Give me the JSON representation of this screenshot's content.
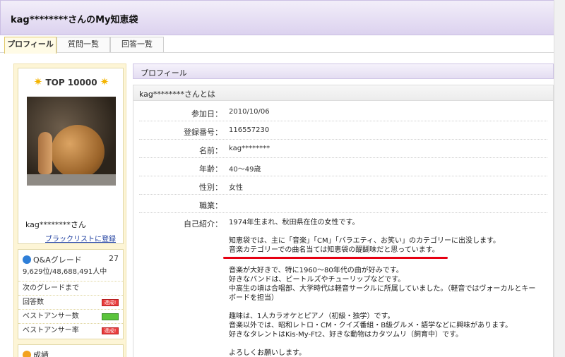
{
  "header": {
    "title": "kag********さんのMy知恵袋"
  },
  "tabs": [
    {
      "label": "プロフィール"
    },
    {
      "label": "質問一覧"
    },
    {
      "label": "回答一覧"
    }
  ],
  "sidebar": {
    "rank_badge": "TOP 10000",
    "username": "kag********さん",
    "blacklist_link": "ブラックリストに登録",
    "grade": {
      "title": "Q&Aグレード",
      "level": "27",
      "rank_text": "9,629位/48,688,491人中",
      "next_grade_label": "次のグレードまで",
      "rows": [
        {
          "label": "回答数",
          "badge": "達成!"
        },
        {
          "label": "ベストアンサー数",
          "badge": ""
        },
        {
          "label": "ベストアンサー率",
          "badge": "達成!"
        }
      ]
    },
    "results_title": "成績"
  },
  "main": {
    "section_title": "プロフィール",
    "about_title": "kag********さんとは",
    "fields": [
      {
        "label": "参加日：",
        "value": "2010/10/06"
      },
      {
        "label": "登録番号：",
        "value": "116557230"
      },
      {
        "label": "名前：",
        "value": "kag********"
      },
      {
        "label": "年齢：",
        "value": "40～49歳"
      },
      {
        "label": "性別：",
        "value": "女性"
      },
      {
        "label": "職業：",
        "value": ""
      }
    ],
    "intro_label": "自己紹介：",
    "intro_lines": [
      "1974年生まれ、秋田県在住の女性です。",
      "",
      "知恵袋では、主に「音楽」「CM」「バラエティ、お笑い」のカテゴリーに出没します。",
      "音楽カテゴリーでの曲名当ては知恵袋の醍醐味だと思っています。",
      "",
      "音楽が大好きで、特に1960～80年代の曲が好みです。",
      "好きなバンドは、ビートルズやチューリップなどです。",
      "中高生の頃は合唱部、大学時代は軽音サークルに所属していました。（軽音ではヴォーカルとキー",
      "ボードを担当）",
      "",
      "趣味は、1人カラオケとピアノ（初級・独学）です。",
      "音楽以外では、昭和レトロ・CM・クイズ番組・B級グルメ・語学などに興味があります。",
      "好きなタレントはKis-My-Ft2、好きな動物はカタツムリ（飼育中）です。",
      "",
      "よろしくお願いします。"
    ]
  }
}
